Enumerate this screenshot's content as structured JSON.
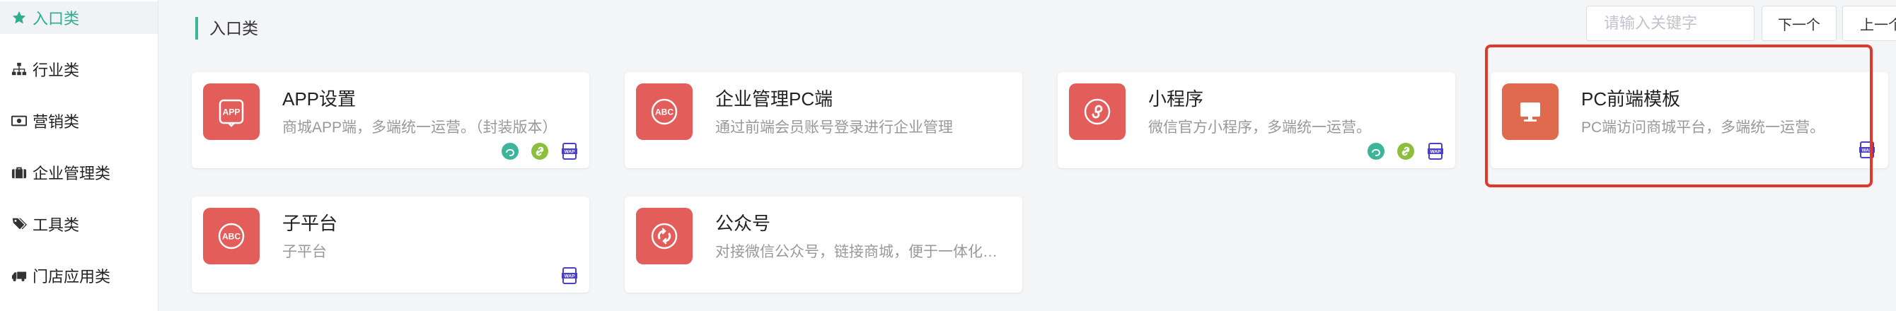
{
  "sidebar": {
    "items": [
      {
        "label": "入口类",
        "icon": "star-icon",
        "active": true
      },
      {
        "label": "行业类",
        "icon": "sitemap-icon"
      },
      {
        "label": "营销类",
        "icon": "money-icon"
      },
      {
        "label": "企业管理类",
        "icon": "briefcase-icon"
      },
      {
        "label": "工具类",
        "icon": "tags-icon"
      },
      {
        "label": "门店应用类",
        "icon": "truck-icon"
      }
    ]
  },
  "header": {
    "title": "入口类",
    "search_placeholder": "请输入关键字",
    "next_label": "下一个",
    "prev_label": "上一个"
  },
  "cards": [
    {
      "title": "APP设置",
      "desc": "商城APP端，多端统一运营。（封装版本）",
      "icon": "app-icon",
      "badges": [
        "mini-program-icon",
        "link-icon",
        "wap-icon"
      ]
    },
    {
      "title": "企业管理PC端",
      "desc": "通过前端会员账号登录进行企业管理",
      "icon": "abc-icon",
      "badges": []
    },
    {
      "title": "小程序",
      "desc": "微信官方小程序，多端统一运营。",
      "icon": "mini-program-icon",
      "badges": [
        "mini-program-icon",
        "link-icon",
        "wap-icon"
      ]
    },
    {
      "title": "PC前端模板",
      "desc": "PC端访问商城平台，多端统一运营。",
      "icon": "monitor-icon",
      "badges": [
        "wap-icon"
      ]
    },
    {
      "title": "子平台",
      "desc": "子平台",
      "icon": "abc-icon",
      "badges": [
        "wap-icon"
      ]
    },
    {
      "title": "公众号",
      "desc": "对接微信公众号，链接商城，便于一体化管理",
      "icon": "wechat-official-icon",
      "badges": []
    }
  ],
  "colors": {
    "accent": "#2fae8e",
    "card_icon_bg": "#e35d5b",
    "pc_icon_bg": "#df6a4e",
    "highlight": "#e0392b",
    "badge_green": "#3cb59a",
    "badge_olive": "#8bbf3c",
    "badge_blue": "#4a3fc9"
  }
}
